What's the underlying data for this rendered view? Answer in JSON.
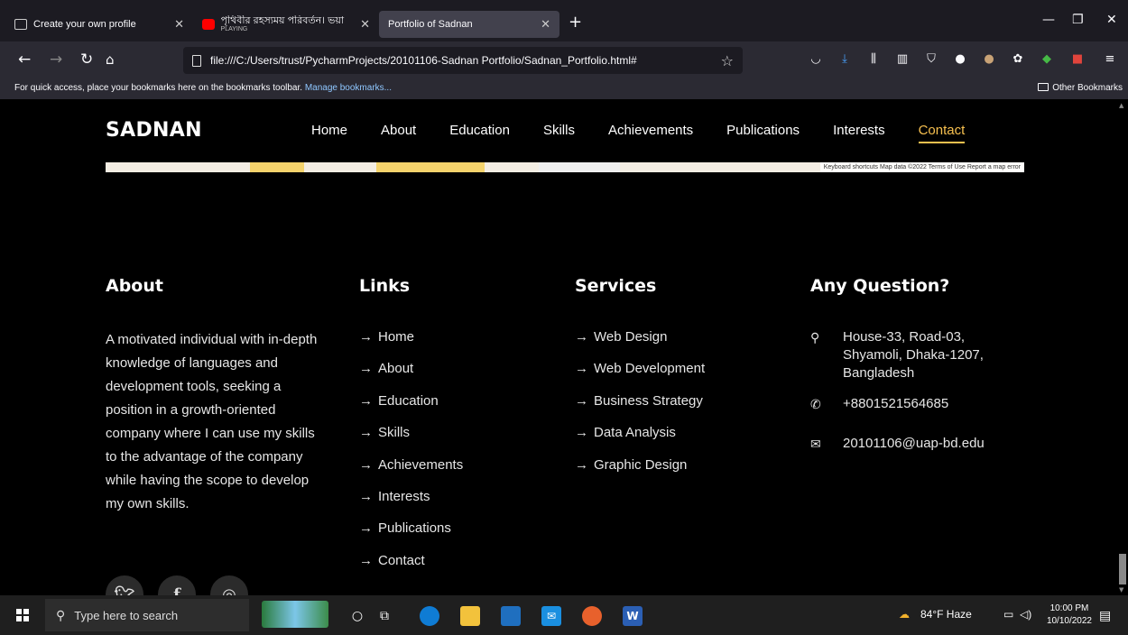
{
  "browser": {
    "tabs": [
      {
        "title": "Create your own profile",
        "sub": ""
      },
      {
        "title": "পৃথিবীর রহস্যময় পরিবর্তন। ভয়া",
        "sub": "PLAYING"
      },
      {
        "title": "Portfolio of Sadnan",
        "sub": ""
      }
    ],
    "url": "file:///C:/Users/trust/PycharmProjects/20101106-Sadnan Portfolio/Sadnan_Portfolio.html#",
    "bookmarks_hint": "For quick access, place your bookmarks here on the bookmarks toolbar.",
    "manage_bookmarks": "Manage bookmarks...",
    "other_bookmarks": "Other Bookmarks"
  },
  "site": {
    "logo": "SADNAN",
    "menu": [
      {
        "label": "Home"
      },
      {
        "label": "About"
      },
      {
        "label": "Education"
      },
      {
        "label": "Skills"
      },
      {
        "label": "Achievements"
      },
      {
        "label": "Publications"
      },
      {
        "label": "Interests"
      },
      {
        "label": "Contact"
      }
    ],
    "map_attribution": "Keyboard shortcuts   Map data ©2022   Terms of Use   Report a map error"
  },
  "footer": {
    "about": {
      "heading": "About",
      "text": "A motivated individual with in-depth knowledge of languages and development tools, seeking a position in a growth-oriented company where I can use my skills to the advantage of the company while having the scope to develop my own skills."
    },
    "links": {
      "heading": "Links",
      "items": [
        "Home",
        "About",
        "Education",
        "Skills",
        "Achievements",
        "Interests",
        "Publications",
        "Contact"
      ]
    },
    "services": {
      "heading": "Services",
      "items": [
        "Web Design",
        "Web Development",
        "Business Strategy",
        "Data Analysis",
        "Graphic Design"
      ]
    },
    "contact": {
      "heading": "Any Question?",
      "address": "House-33, Road-03, Shyamoli, Dhaka-1207, Bangladesh",
      "phone": "+8801521564685",
      "email": "20101106@uap-bd.edu"
    },
    "arrow": "→"
  },
  "taskbar": {
    "search_placeholder": "Type here to search",
    "weather": "84°F  Haze",
    "time": "10:00 PM",
    "date": "10/10/2022"
  },
  "colors": {
    "accent": "#f7c04f",
    "background": "#000000"
  }
}
